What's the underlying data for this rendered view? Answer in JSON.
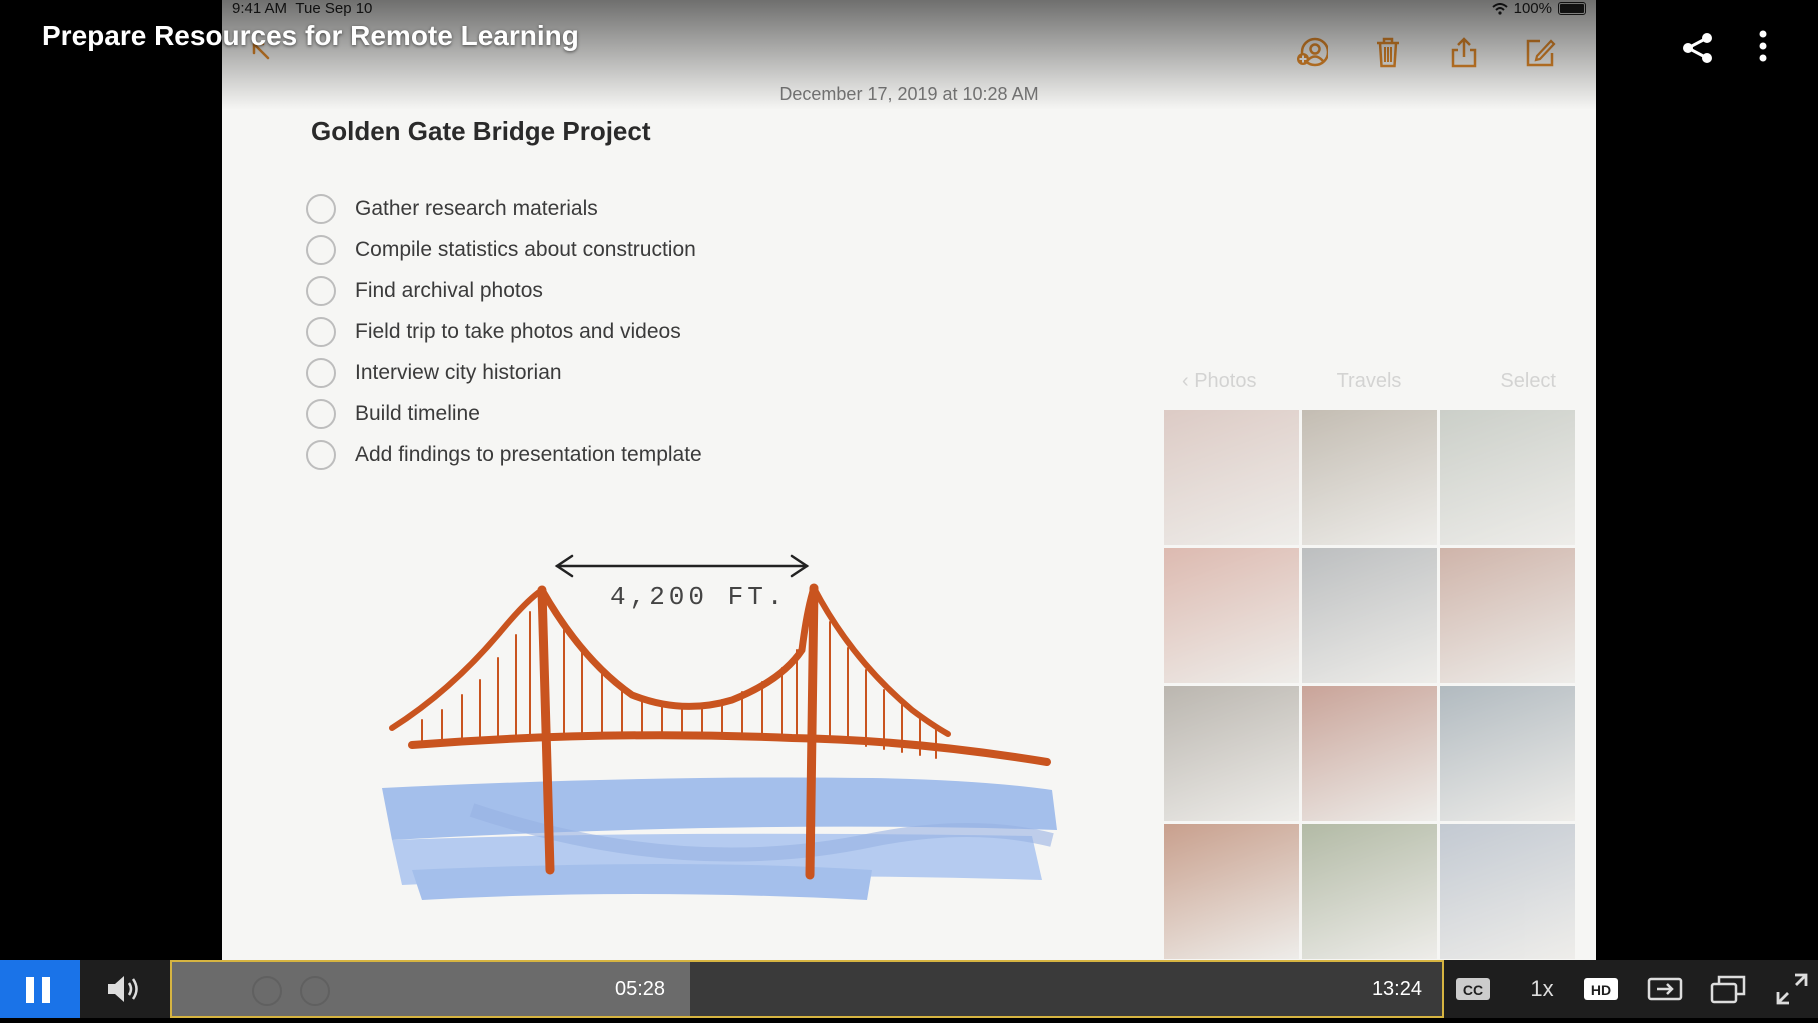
{
  "video": {
    "title": "Prepare Resources for Remote Learning",
    "current_time": "05:28",
    "total_time": "13:24",
    "progress": 0.408,
    "speed_label": "1x",
    "cc_label": "CC",
    "hd_label": "HD"
  },
  "ipad": {
    "status": {
      "time": "9:41 AM",
      "date": "Tue Sep 10",
      "battery": "100%"
    },
    "note": {
      "date": "December 17, 2019 at 10:28 AM",
      "title": "Golden Gate Bridge Project",
      "checklist": [
        "Gather research materials",
        "Compile statistics about construction",
        "Find archival photos",
        "Field trip to take photos and videos",
        "Interview city historian",
        "Build timeline",
        "Add findings to presentation template"
      ],
      "drawing_label": "4,200 FT."
    },
    "photos_panel": {
      "back_label": "Photos",
      "title": "Travels",
      "select_label": "Select"
    }
  },
  "colors": {
    "accent_orange": "#e0892b",
    "bridge": "#c9541f",
    "water": "#6f9be6",
    "play_button": "#1a73e8",
    "progress_border": "#d6b441"
  },
  "photo_tiles": [
    "#c9a9a0",
    "#9b8f7e",
    "#a9b0a6",
    "#c98a7a",
    "#8e9296",
    "#b07f6e",
    "#8b8378",
    "#a5614f",
    "#7a8a96",
    "#a45a3a",
    "#7c8a66",
    "#9aa6b7"
  ]
}
